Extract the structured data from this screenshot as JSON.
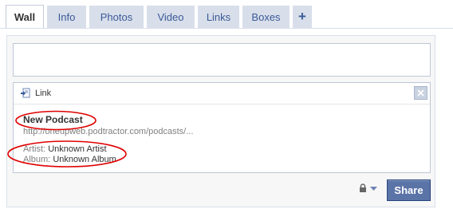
{
  "tabs": [
    {
      "label": "Wall",
      "active": true
    },
    {
      "label": "Info",
      "active": false
    },
    {
      "label": "Photos",
      "active": false
    },
    {
      "label": "Video",
      "active": false
    },
    {
      "label": "Links",
      "active": false
    },
    {
      "label": "Boxes",
      "active": false
    },
    {
      "label": "+",
      "active": false
    }
  ],
  "composer": {
    "text_value": ""
  },
  "attachment": {
    "type_label": "Link",
    "title": "New Podcast",
    "url": "http://oneupweb.podtractor.com/podcasts/...",
    "artist_label": "Artist:",
    "artist_value": "Unknown Artist",
    "album_label": "Album:",
    "album_value": "Unknown Album"
  },
  "share_button": "Share",
  "colors": {
    "brand": "#3b5998",
    "tab_bg": "#d8dfea",
    "share_bg": "#5b74a8",
    "annotation": "#e00000"
  }
}
